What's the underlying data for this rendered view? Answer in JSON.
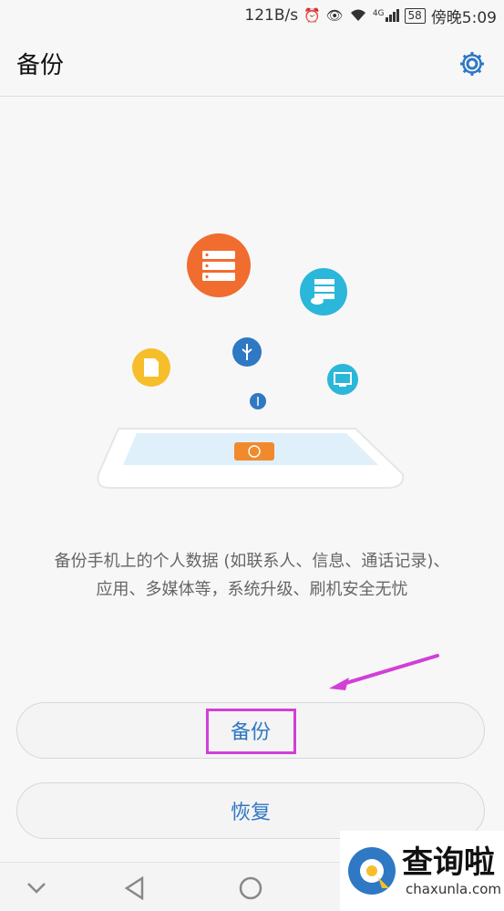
{
  "status_bar": {
    "speed": "121B/s",
    "battery": "58",
    "carrier_time": "傍晚5:09",
    "network": "4G"
  },
  "header": {
    "title": "备份"
  },
  "description": {
    "line1": "备份手机上的个人数据 (如联系人、信息、通话记录)、",
    "line2": "应用、多媒体等，系统升级、刷机安全无忧"
  },
  "buttons": {
    "backup": "备份",
    "restore": "恢复"
  },
  "watermark": {
    "cn": "查询啦",
    "en": "chaxunla.com"
  },
  "colors": {
    "accent": "#2f78c4",
    "highlight": "#d23fd7",
    "orange": "#f06c2f",
    "cyan": "#2bb7d9",
    "yellow": "#f7be2c",
    "blue": "#2f78c4"
  },
  "icons": [
    "alarm-icon",
    "eye-icon",
    "wifi-icon",
    "signal-icon",
    "gear-icon",
    "server-icon",
    "cloud-server-icon",
    "usb-icon",
    "sd-card-icon",
    "monitor-icon",
    "restore-icon"
  ]
}
